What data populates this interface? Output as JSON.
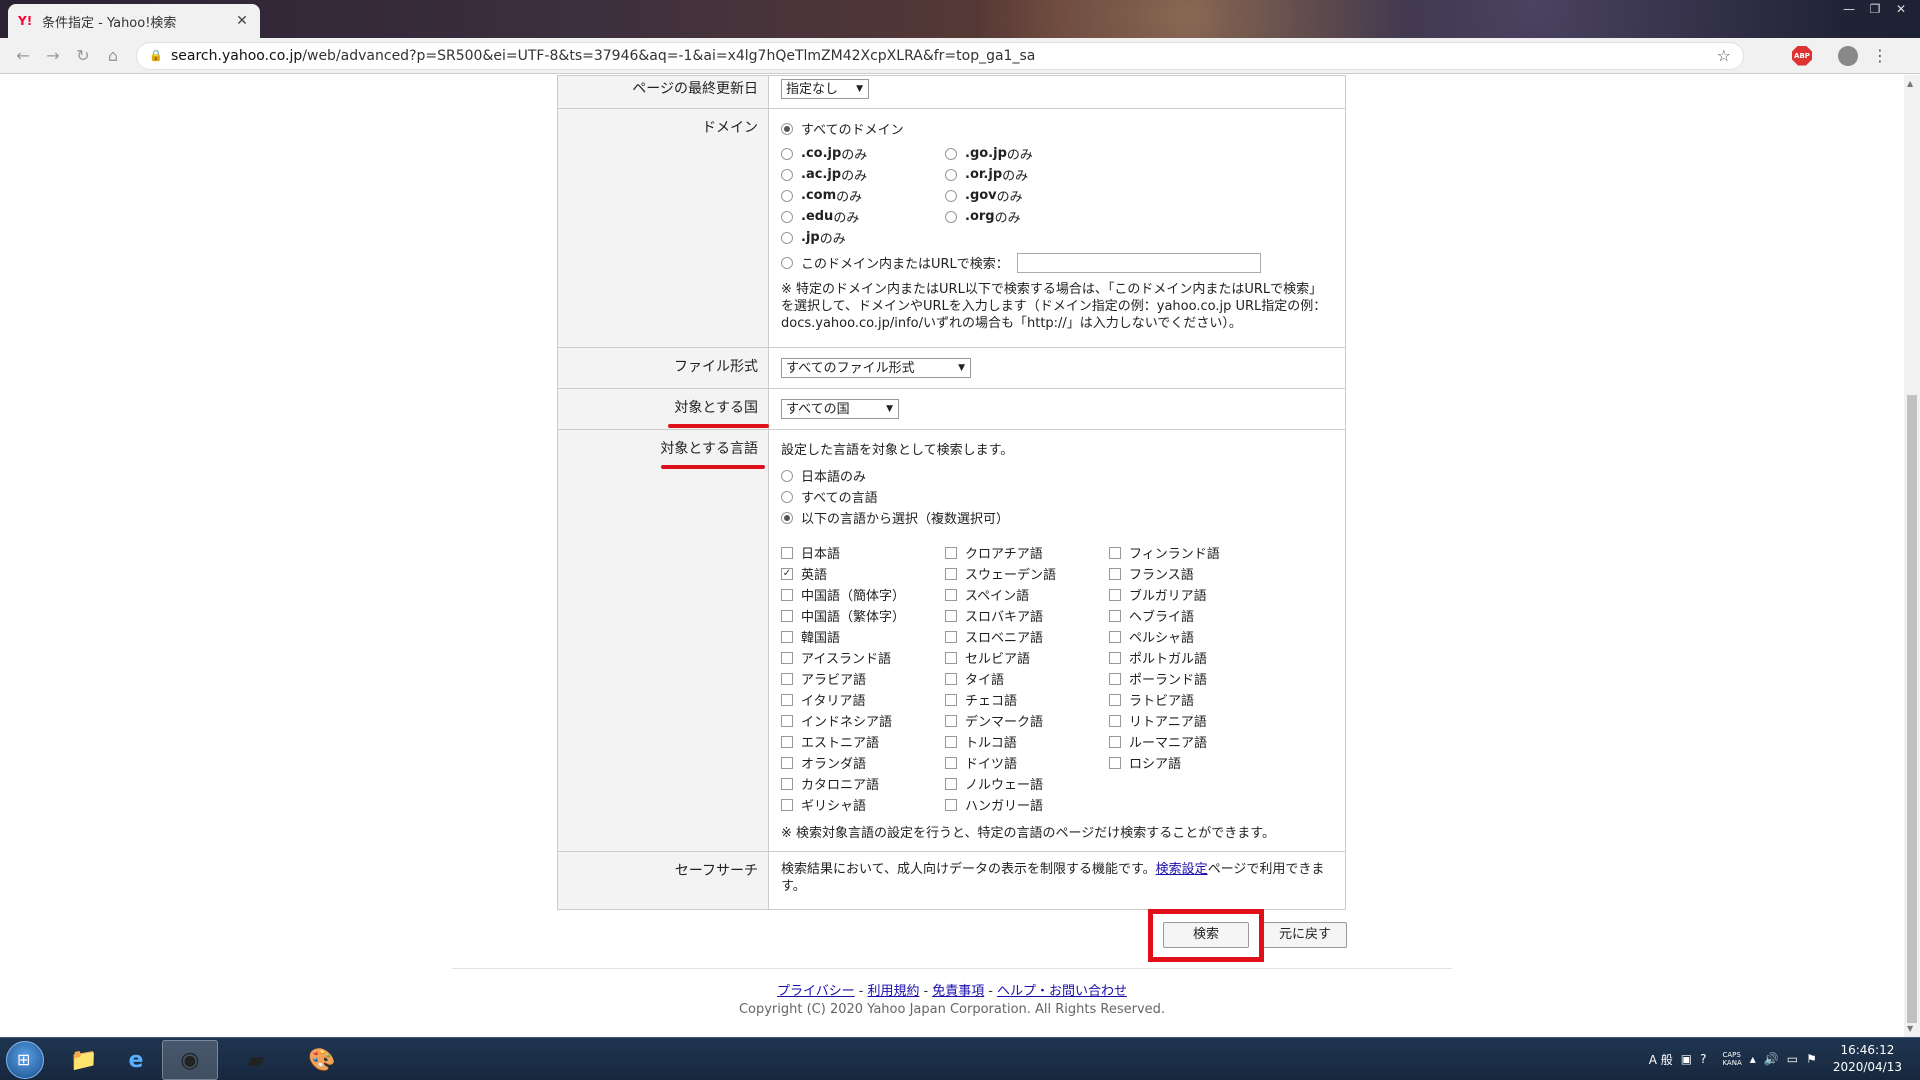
{
  "browser": {
    "tab_title": "条件指定 - Yahoo!検索",
    "tab_favicon": "Y!",
    "url_host": "search.yahoo.co.jp",
    "url_path": "/web/advanced?p=SR500&ei=UTF-8&ts=37946&aq=-1&ai=x4lg7hQeTlmZM42XcpXLRA&fr=top_ga1_sa",
    "abp_label": "ABP"
  },
  "form": {
    "last_updated": {
      "label": "ページの最終更新日",
      "value": "指定なし"
    },
    "domain": {
      "label": "ドメイン",
      "all": "すべてのドメイン",
      "options": [
        [
          ".co.jp",
          " のみ"
        ],
        [
          ".go.jp",
          " のみ"
        ],
        [
          ".ac.jp",
          " のみ"
        ],
        [
          ".or.jp",
          " のみ"
        ],
        [
          ".com",
          " のみ"
        ],
        [
          ".gov",
          " のみ"
        ],
        [
          ".edu",
          " のみ"
        ],
        [
          ".org",
          " のみ"
        ],
        [
          ".jp",
          " のみ"
        ]
      ],
      "custom": "このドメイン内またはURLで検索：",
      "note": "※ 特定のドメイン内またはURL以下で検索する場合は、「このドメイン内またはURLで検索」を選択して、ドメインやURLを入力します（ドメイン指定の例：yahoo.co.jp URL指定の例：docs.yahoo.co.jp/info/いずれの場合も「http://」は入力しないでください）。"
    },
    "file_type": {
      "label": "ファイル形式",
      "value": "すべてのファイル形式"
    },
    "country": {
      "label": "対象とする国",
      "value": "すべての国"
    },
    "language": {
      "label": "対象とする言語",
      "intro": "設定した言語を対象として検索します。",
      "radio_japanese": "日本語のみ",
      "radio_all": "すべての言語",
      "radio_select": "以下の言語から選択（複数選択可）",
      "items": [
        "日本語",
        "クロアチア語",
        "フィンランド語",
        "英語",
        "スウェーデン語",
        "フランス語",
        "中国語（簡体字）",
        "スペイン語",
        "ブルガリア語",
        "中国語（繁体字）",
        "スロバキア語",
        "ヘブライ語",
        "韓国語",
        "スロベニア語",
        "ペルシャ語",
        "アイスランド語",
        "セルビア語",
        "ポルトガル語",
        "アラビア語",
        "タイ語",
        "ポーランド語",
        "イタリア語",
        "チェコ語",
        "ラトビア語",
        "インドネシア語",
        "デンマーク語",
        "リトアニア語",
        "エストニア語",
        "トルコ語",
        "ルーマニア語",
        "オランダ語",
        "ドイツ語",
        "ロシア語",
        "カタロニア語",
        "ノルウェー語",
        "",
        "ギリシャ語",
        "ハンガリー語",
        ""
      ],
      "checked": [
        "英語"
      ],
      "note": "※ 検索対象言語の設定を行うと、特定の言語のページだけ検索することができます。"
    },
    "safe_search": {
      "label": "セーフサーチ",
      "text_before": "検索結果において、成人向けデータの表示を制限する機能です。",
      "link": "検索設定",
      "text_after": "ページで利用できます。"
    }
  },
  "buttons": {
    "search": "検索",
    "reset": "元に戻す"
  },
  "footer": {
    "links": [
      "プライバシー",
      "利用規約",
      "免責事項",
      "ヘルプ・お問い合わせ"
    ],
    "separator": "-",
    "copyright": "Copyright (C) 2020 Yahoo Japan Corporation. All Rights Reserved."
  },
  "taskbar": {
    "time": "16:46:12",
    "date": "2020/04/13",
    "ime": "A 般",
    "caps": "CAPS",
    "kana": "KANA"
  },
  "colors": {
    "highlight": "#e0101a",
    "link": "#1a0dab"
  }
}
